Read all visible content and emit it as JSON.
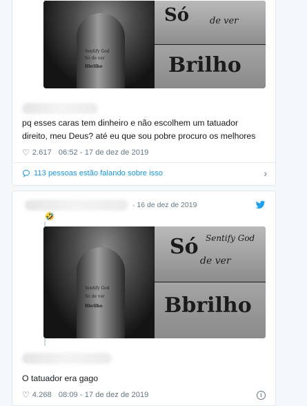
{
  "tweet1": {
    "text_line1": "pq esses caras tem dinheiro e não escolhem um tatuador",
    "text_line2": "direito, meu Deus? até eu que sou pobre procuro os melhores",
    "likes": "2.617",
    "timestamp": "06:52 - 17 de dez de 2019",
    "conversation": "113 pessoas estão falando sobre isso",
    "tattoo_word": "Brilho",
    "tattoo_word_top": "Só de ver"
  },
  "tweet2": {
    "date": "· 16 de dez de 2019",
    "emoji": "🤣",
    "text": "O tatuador era gago",
    "likes": "4.268",
    "timestamp": "08:09 - 17 de dez de 2019",
    "tattoo_word": "Bbrilho",
    "tattoo_word_top": "Só de ver",
    "tattoo_script": "Sentify God"
  },
  "colors": {
    "background": "#f5f8fa",
    "card": "#ffffff",
    "link": "#1b95e0",
    "meta": "#657786",
    "twitter_blue": "#1da1f2"
  },
  "icons": [
    "heart-icon",
    "comment-icon",
    "chevron-right-icon",
    "twitter-bird-icon",
    "info-icon"
  ]
}
